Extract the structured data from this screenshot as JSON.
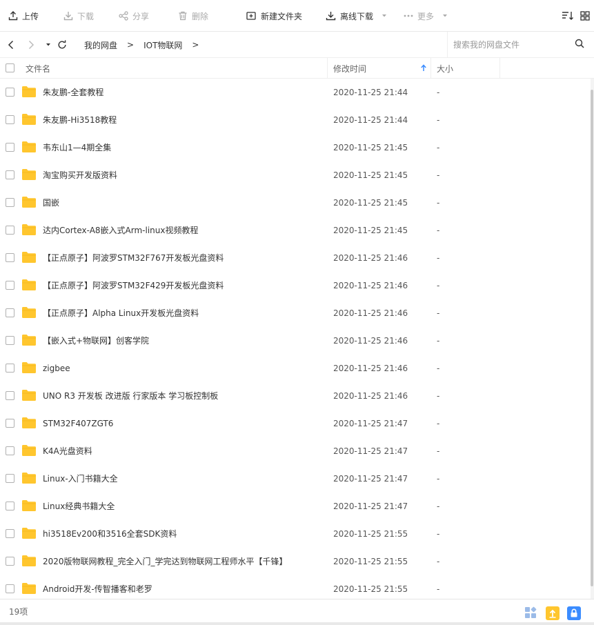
{
  "toolbar": {
    "upload": "上传",
    "download": "下载",
    "share": "分享",
    "delete": "删除",
    "new_folder": "新建文件夹",
    "offline_download": "离线下载",
    "more": "更多"
  },
  "nav": {
    "breadcrumbs": [
      "我的网盘",
      "IOT物联网"
    ],
    "separator": ">",
    "search_placeholder": "搜索我的网盘文件"
  },
  "columns": {
    "name": "文件名",
    "modified": "修改时间",
    "size": "大小",
    "sort_direction": "ascending"
  },
  "files": [
    {
      "name": "朱友鹏-全套教程",
      "modified": "2020-11-25 21:44",
      "size": "-"
    },
    {
      "name": "朱友鹏-Hi3518教程",
      "modified": "2020-11-25 21:44",
      "size": "-"
    },
    {
      "name": "韦东山1—4期全集",
      "modified": "2020-11-25 21:45",
      "size": "-"
    },
    {
      "name": "淘宝购买开发版资料",
      "modified": "2020-11-25 21:45",
      "size": "-"
    },
    {
      "name": "国嵌",
      "modified": "2020-11-25 21:45",
      "size": "-"
    },
    {
      "name": "达内Cortex-A8嵌入式Arm-linux视频教程",
      "modified": "2020-11-25 21:45",
      "size": "-"
    },
    {
      "name": "【正点原子】阿波罗STM32F767开发板光盘资料",
      "modified": "2020-11-25 21:46",
      "size": "-"
    },
    {
      "name": "【正点原子】阿波罗STM32F429开发板光盘资料",
      "modified": "2020-11-25 21:46",
      "size": "-"
    },
    {
      "name": "【正点原子】Alpha Linux开发板光盘资料",
      "modified": "2020-11-25 21:46",
      "size": "-"
    },
    {
      "name": "【嵌入式+物联网】创客学院",
      "modified": "2020-11-25 21:46",
      "size": "-"
    },
    {
      "name": "zigbee",
      "modified": "2020-11-25 21:46",
      "size": "-"
    },
    {
      "name": "UNO R3 开发板 改进版 行家版本 学习板控制板",
      "modified": "2020-11-25 21:46",
      "size": "-"
    },
    {
      "name": "STM32F407ZGT6",
      "modified": "2020-11-25 21:47",
      "size": "-"
    },
    {
      "name": "K4A光盘资料",
      "modified": "2020-11-25 21:47",
      "size": "-"
    },
    {
      "name": "Linux-入门书籍大全",
      "modified": "2020-11-25 21:47",
      "size": "-"
    },
    {
      "name": "Linux经典书籍大全",
      "modified": "2020-11-25 21:47",
      "size": "-"
    },
    {
      "name": "hi3518Ev200和3516全套SDK资料",
      "modified": "2020-11-25 21:55",
      "size": "-"
    },
    {
      "name": "2020版物联网教程_完全入门_学完达到物联网工程师水平【千锋】",
      "modified": "2020-11-25 21:55",
      "size": "-"
    },
    {
      "name": "Android开发-传智播客和老罗",
      "modified": "2020-11-25 21:55",
      "size": "-"
    }
  ],
  "status": {
    "count": "19项"
  },
  "colors": {
    "folder": "#ffc62e",
    "accent": "#3b8cff",
    "upload_badge": "#ffc62e",
    "lock_badge": "#3b8cff"
  },
  "icons": {
    "upload": "upload-icon",
    "download": "download-icon",
    "share": "share-icon",
    "delete": "trash-icon",
    "new_folder": "new-folder-icon",
    "offline_download": "offline-download-icon",
    "more": "more-dots-icon",
    "sort": "sort-icon",
    "grid": "grid-view-icon",
    "back": "back-arrow-icon",
    "forward": "forward-arrow-icon",
    "history": "history-dropdown-icon",
    "refresh": "refresh-icon",
    "search": "search-icon",
    "folder": "folder-icon",
    "apps": "apps-icon",
    "transfer": "upload-transfer-icon",
    "lock": "lock-icon"
  }
}
